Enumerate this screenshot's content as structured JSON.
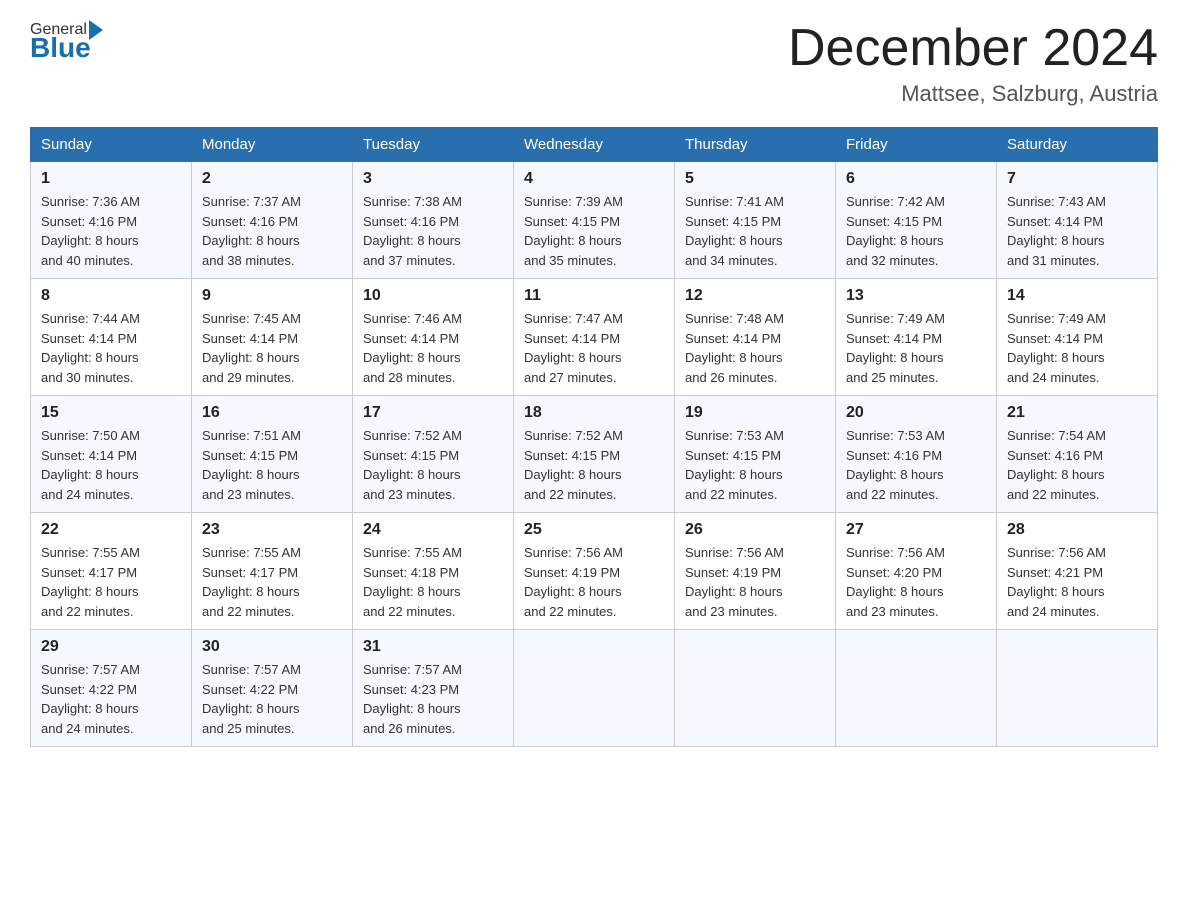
{
  "logo": {
    "general": "General",
    "blue": "Blue"
  },
  "header": {
    "month": "December 2024",
    "location": "Mattsee, Salzburg, Austria"
  },
  "days_of_week": [
    "Sunday",
    "Monday",
    "Tuesday",
    "Wednesday",
    "Thursday",
    "Friday",
    "Saturday"
  ],
  "weeks": [
    [
      {
        "day": "1",
        "sunrise": "7:36 AM",
        "sunset": "4:16 PM",
        "daylight": "8 hours and 40 minutes."
      },
      {
        "day": "2",
        "sunrise": "7:37 AM",
        "sunset": "4:16 PM",
        "daylight": "8 hours and 38 minutes."
      },
      {
        "day": "3",
        "sunrise": "7:38 AM",
        "sunset": "4:16 PM",
        "daylight": "8 hours and 37 minutes."
      },
      {
        "day": "4",
        "sunrise": "7:39 AM",
        "sunset": "4:15 PM",
        "daylight": "8 hours and 35 minutes."
      },
      {
        "day": "5",
        "sunrise": "7:41 AM",
        "sunset": "4:15 PM",
        "daylight": "8 hours and 34 minutes."
      },
      {
        "day": "6",
        "sunrise": "7:42 AM",
        "sunset": "4:15 PM",
        "daylight": "8 hours and 32 minutes."
      },
      {
        "day": "7",
        "sunrise": "7:43 AM",
        "sunset": "4:14 PM",
        "daylight": "8 hours and 31 minutes."
      }
    ],
    [
      {
        "day": "8",
        "sunrise": "7:44 AM",
        "sunset": "4:14 PM",
        "daylight": "8 hours and 30 minutes."
      },
      {
        "day": "9",
        "sunrise": "7:45 AM",
        "sunset": "4:14 PM",
        "daylight": "8 hours and 29 minutes."
      },
      {
        "day": "10",
        "sunrise": "7:46 AM",
        "sunset": "4:14 PM",
        "daylight": "8 hours and 28 minutes."
      },
      {
        "day": "11",
        "sunrise": "7:47 AM",
        "sunset": "4:14 PM",
        "daylight": "8 hours and 27 minutes."
      },
      {
        "day": "12",
        "sunrise": "7:48 AM",
        "sunset": "4:14 PM",
        "daylight": "8 hours and 26 minutes."
      },
      {
        "day": "13",
        "sunrise": "7:49 AM",
        "sunset": "4:14 PM",
        "daylight": "8 hours and 25 minutes."
      },
      {
        "day": "14",
        "sunrise": "7:49 AM",
        "sunset": "4:14 PM",
        "daylight": "8 hours and 24 minutes."
      }
    ],
    [
      {
        "day": "15",
        "sunrise": "7:50 AM",
        "sunset": "4:14 PM",
        "daylight": "8 hours and 24 minutes."
      },
      {
        "day": "16",
        "sunrise": "7:51 AM",
        "sunset": "4:15 PM",
        "daylight": "8 hours and 23 minutes."
      },
      {
        "day": "17",
        "sunrise": "7:52 AM",
        "sunset": "4:15 PM",
        "daylight": "8 hours and 23 minutes."
      },
      {
        "day": "18",
        "sunrise": "7:52 AM",
        "sunset": "4:15 PM",
        "daylight": "8 hours and 22 minutes."
      },
      {
        "day": "19",
        "sunrise": "7:53 AM",
        "sunset": "4:15 PM",
        "daylight": "8 hours and 22 minutes."
      },
      {
        "day": "20",
        "sunrise": "7:53 AM",
        "sunset": "4:16 PM",
        "daylight": "8 hours and 22 minutes."
      },
      {
        "day": "21",
        "sunrise": "7:54 AM",
        "sunset": "4:16 PM",
        "daylight": "8 hours and 22 minutes."
      }
    ],
    [
      {
        "day": "22",
        "sunrise": "7:55 AM",
        "sunset": "4:17 PM",
        "daylight": "8 hours and 22 minutes."
      },
      {
        "day": "23",
        "sunrise": "7:55 AM",
        "sunset": "4:17 PM",
        "daylight": "8 hours and 22 minutes."
      },
      {
        "day": "24",
        "sunrise": "7:55 AM",
        "sunset": "4:18 PM",
        "daylight": "8 hours and 22 minutes."
      },
      {
        "day": "25",
        "sunrise": "7:56 AM",
        "sunset": "4:19 PM",
        "daylight": "8 hours and 22 minutes."
      },
      {
        "day": "26",
        "sunrise": "7:56 AM",
        "sunset": "4:19 PM",
        "daylight": "8 hours and 23 minutes."
      },
      {
        "day": "27",
        "sunrise": "7:56 AM",
        "sunset": "4:20 PM",
        "daylight": "8 hours and 23 minutes."
      },
      {
        "day": "28",
        "sunrise": "7:56 AM",
        "sunset": "4:21 PM",
        "daylight": "8 hours and 24 minutes."
      }
    ],
    [
      {
        "day": "29",
        "sunrise": "7:57 AM",
        "sunset": "4:22 PM",
        "daylight": "8 hours and 24 minutes."
      },
      {
        "day": "30",
        "sunrise": "7:57 AM",
        "sunset": "4:22 PM",
        "daylight": "8 hours and 25 minutes."
      },
      {
        "day": "31",
        "sunrise": "7:57 AM",
        "sunset": "4:23 PM",
        "daylight": "8 hours and 26 minutes."
      },
      null,
      null,
      null,
      null
    ]
  ],
  "labels": {
    "sunrise": "Sunrise:",
    "sunset": "Sunset:",
    "daylight": "Daylight:"
  }
}
